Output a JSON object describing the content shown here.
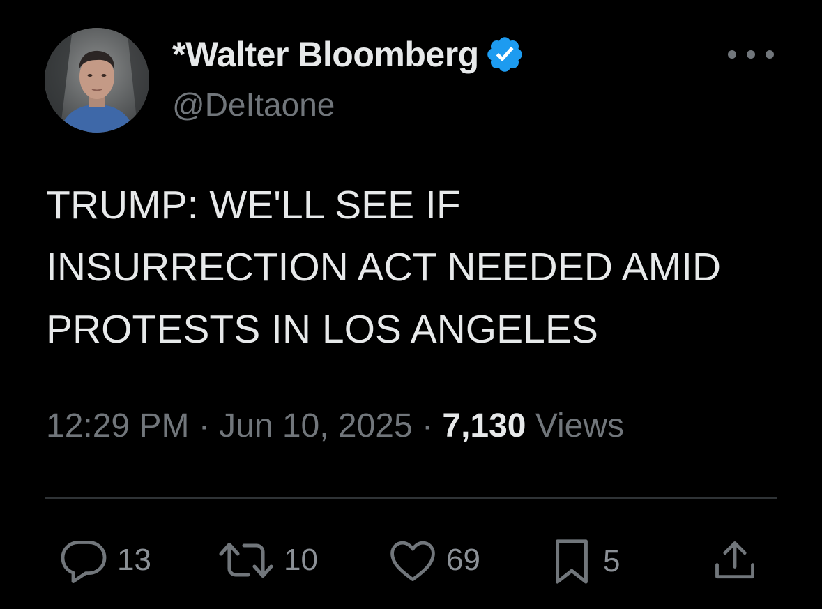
{
  "author": {
    "display_name": "*Walter Bloomberg",
    "handle": "@DeItaone",
    "verified_color": "#1d9bf0"
  },
  "tweet": {
    "lines": [
      "TRUMP: WE'LL SEE IF",
      "INSURRECTION ACT NEEDED AMID",
      "PROTESTS IN LOS ANGELES"
    ],
    "time": "12:29 PM",
    "separator": "·",
    "date": "Jun 10, 2025",
    "views_count": "7,130",
    "views_label": "Views"
  },
  "actions": {
    "reply_count": "13",
    "retweet_count": "10",
    "like_count": "69",
    "bookmark_count": "5"
  },
  "icons": [
    "more-icon",
    "verified-badge-icon",
    "reply-icon",
    "retweet-icon",
    "like-icon",
    "bookmark-icon",
    "share-icon"
  ],
  "colors": {
    "background": "#000000",
    "text_primary": "#e7e9ea",
    "text_secondary": "#71767b",
    "divider": "#2f3336"
  }
}
